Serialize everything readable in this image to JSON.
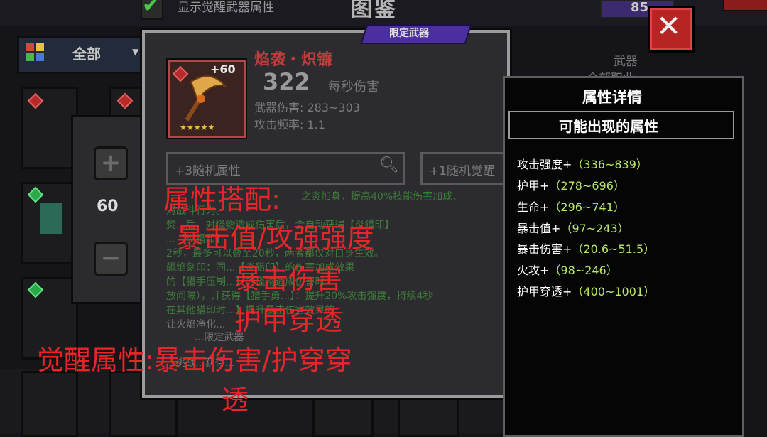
{
  "header": {
    "awaken_toggle_label": "显示觉醒武器属性",
    "title": "图鉴",
    "currency_value": "85"
  },
  "filter": {
    "selected": "全部"
  },
  "stepper": {
    "plus": "+",
    "value": "60",
    "minus": "−"
  },
  "weapon": {
    "tag": "限定武器",
    "enhance_level": "+60",
    "name": "焰袭・炽镰",
    "dps": "322",
    "dps_label": "每秒伤害",
    "damage": "武器伤害: 283~303",
    "attack_rate": "攻击频率: 1.1",
    "category": "武器",
    "class": "全部职业",
    "random_attr_field": "+3随机属性",
    "awaken_attr_field": "+1随机觉醒",
    "desc_lines": [
      "之炎加身，提高40%技能伤害加成、",
      "对战斗行为。",
      "焚...后，对怪物造成伤害后，会自动获得【炎猎印】",
      "...【炎猎印】",
      "2秒，最多可以叠至20秒，两者都仅对自身生效。",
      "飙焰刻印：同...【炎猎印】的伤害加成效果",
      "的【猎手压制...】的怪物造成伤害时",
      "放间隔），并获得【猎手勇...】：提升20%攻击强度，持续4秒",
      "在其他猎印时...】提升暴击伤害效果的...",
      "让火焰净化...",
      "...限定武器",
      "...挑战...获得..."
    ]
  },
  "attribute_panel": {
    "title": "属性详情",
    "subtitle": "可能出现的属性",
    "items": [
      {
        "name": "攻击强度+",
        "range": "（336~839）"
      },
      {
        "name": "护甲+",
        "range": "（278~696）"
      },
      {
        "name": "生命+",
        "range": "（296~741）"
      },
      {
        "name": "暴击值+",
        "range": "（97~243）"
      },
      {
        "name": "暴击伤害+",
        "range": "（20.6~51.5）"
      },
      {
        "name": "火攻+",
        "range": "（98~246）"
      },
      {
        "name": "护甲穿透+",
        "range": "（400~1001）"
      }
    ]
  },
  "overlay": {
    "line1": "属性搭配:",
    "line2": "暴击值/攻强强度",
    "line3": "暴击伤害",
    "line4": "护甲穿透",
    "line5": "觉醒属性:暴击伤害/护穿穿",
    "line6": "透"
  },
  "colors": {
    "overlay_red": "#e8262a",
    "attr_green": "#b8e86a",
    "weapon_name_red": "#c03c3c",
    "close_red": "#b72424"
  }
}
